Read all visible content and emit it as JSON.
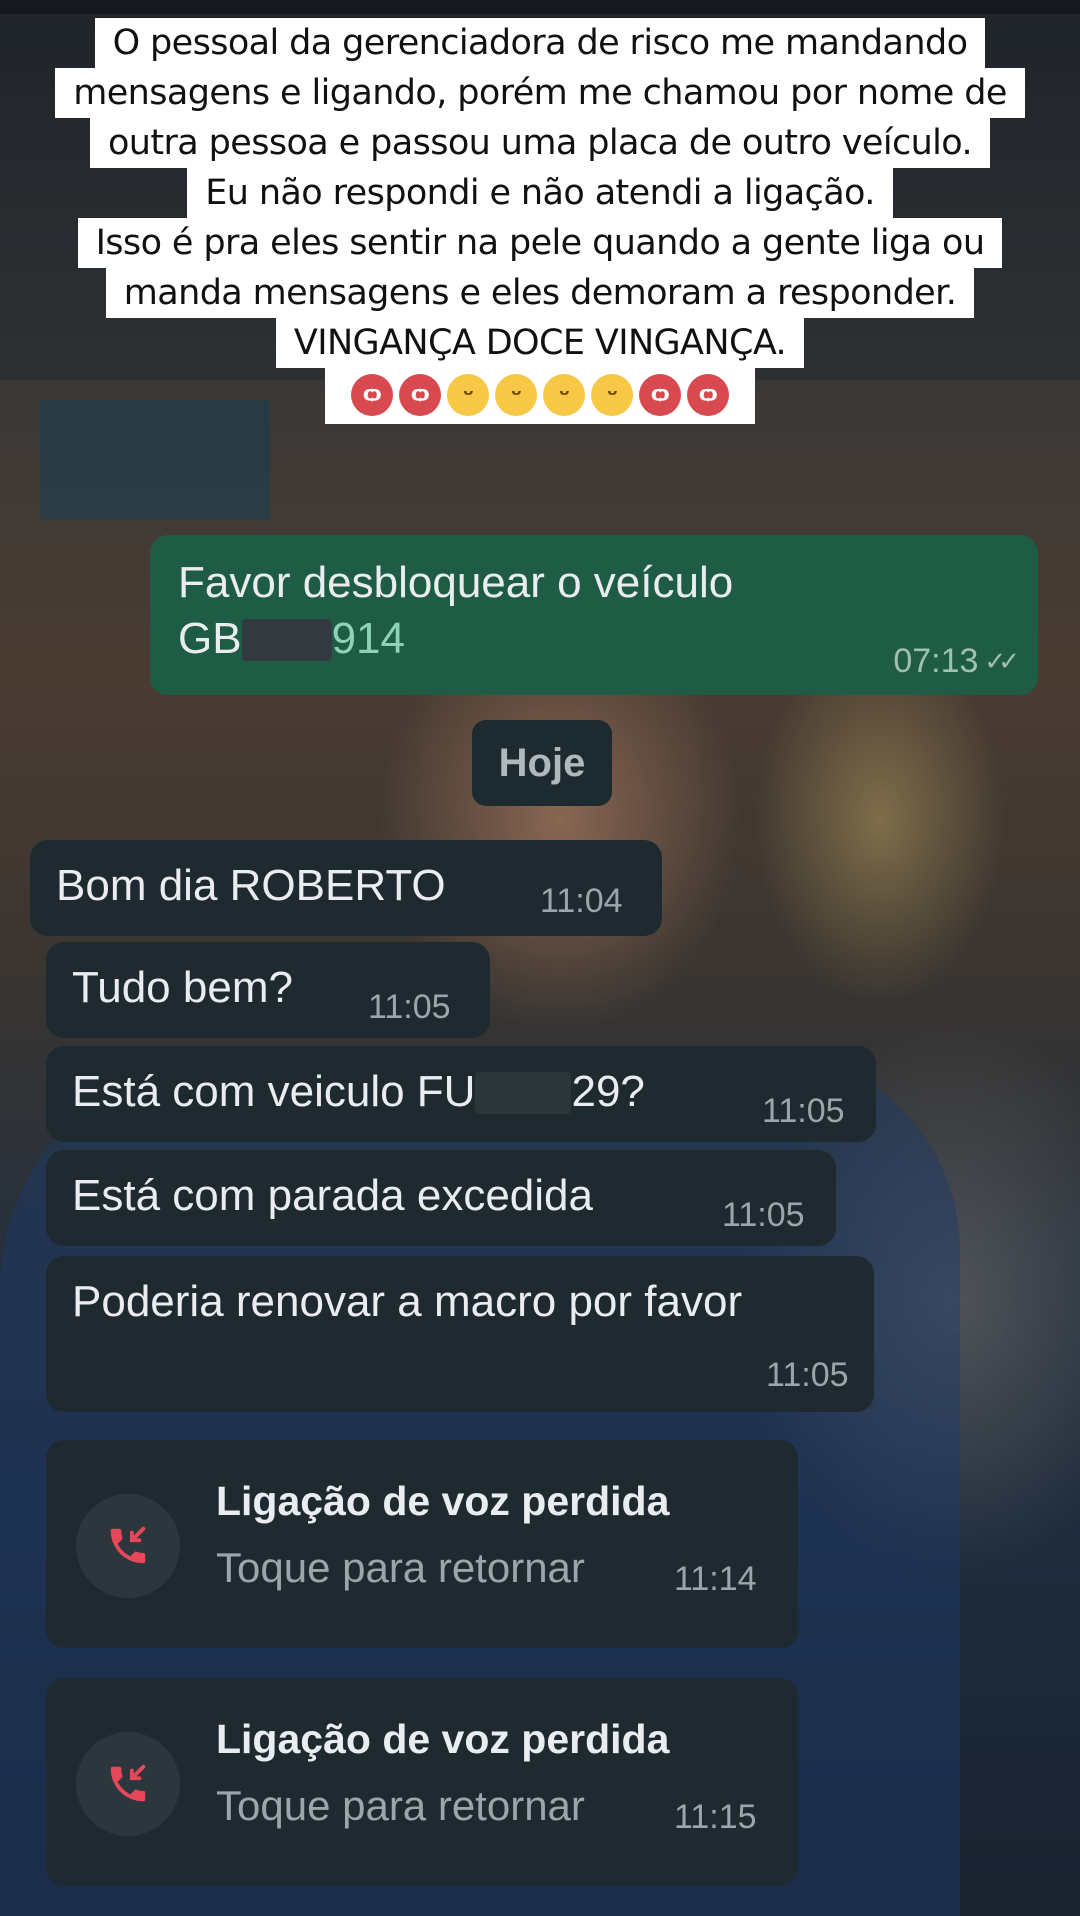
{
  "caption": {
    "lines": [
      "O pessoal da gerenciadora de risco me mandando",
      "mensagens e ligando, porém me chamou por nome de",
      "outra pessoa e passou uma placa de outro veículo.",
      "Eu não respondi e não atendi a ligação.",
      "Isso é pra eles sentir na pele quando a gente liga ou",
      "manda mensagens e eles demoram a responder.",
      "VINGANÇA DOCE VINGANÇA."
    ],
    "emojis": [
      "devil-face",
      "devil-face",
      "grinning-face",
      "grinning-face",
      "grinning-face",
      "grinning-face",
      "devil-face",
      "devil-face"
    ]
  },
  "outgoing": {
    "line1": "Favor desbloquear o veículo",
    "plate_start": "GB",
    "plate_end": "914",
    "time": "07:13"
  },
  "date_chip": "Hoje",
  "incoming": [
    {
      "text": "Bom dia ROBERTO",
      "time": "11:04"
    },
    {
      "text": "Tudo bem?",
      "time": "11:05"
    },
    {
      "text_start": "Está com veiculo FU",
      "text_end": "29?",
      "time": "11:05"
    },
    {
      "text": "Está com parada excedida",
      "time": "11:05"
    },
    {
      "text": "Poderia renovar a macro por favor",
      "time": "11:05"
    }
  ],
  "calls": [
    {
      "title": "Ligação de voz perdida",
      "subtitle": "Toque para retornar",
      "time": "11:14"
    },
    {
      "title": "Ligação de voz perdida",
      "subtitle": "Toque para retornar",
      "time": "11:15"
    }
  ],
  "colors": {
    "outgoing_bubble": "#1f5c45",
    "incoming_bubble": "#1e2a30",
    "missed_call_icon": "#e8475a"
  }
}
